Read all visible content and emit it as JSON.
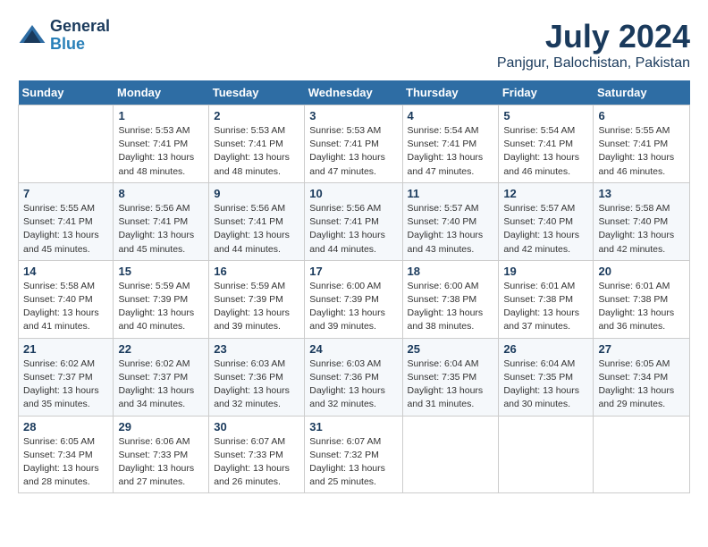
{
  "header": {
    "logo_general": "General",
    "logo_blue": "Blue",
    "title": "July 2024",
    "subtitle": "Panjgur, Balochistan, Pakistan"
  },
  "calendar": {
    "columns": [
      "Sunday",
      "Monday",
      "Tuesday",
      "Wednesday",
      "Thursday",
      "Friday",
      "Saturday"
    ],
    "weeks": [
      [
        {
          "day": "",
          "info": ""
        },
        {
          "day": "1",
          "info": "Sunrise: 5:53 AM\nSunset: 7:41 PM\nDaylight: 13 hours\nand 48 minutes."
        },
        {
          "day": "2",
          "info": "Sunrise: 5:53 AM\nSunset: 7:41 PM\nDaylight: 13 hours\nand 48 minutes."
        },
        {
          "day": "3",
          "info": "Sunrise: 5:53 AM\nSunset: 7:41 PM\nDaylight: 13 hours\nand 47 minutes."
        },
        {
          "day": "4",
          "info": "Sunrise: 5:54 AM\nSunset: 7:41 PM\nDaylight: 13 hours\nand 47 minutes."
        },
        {
          "day": "5",
          "info": "Sunrise: 5:54 AM\nSunset: 7:41 PM\nDaylight: 13 hours\nand 46 minutes."
        },
        {
          "day": "6",
          "info": "Sunrise: 5:55 AM\nSunset: 7:41 PM\nDaylight: 13 hours\nand 46 minutes."
        }
      ],
      [
        {
          "day": "7",
          "info": "Sunrise: 5:55 AM\nSunset: 7:41 PM\nDaylight: 13 hours\nand 45 minutes."
        },
        {
          "day": "8",
          "info": "Sunrise: 5:56 AM\nSunset: 7:41 PM\nDaylight: 13 hours\nand 45 minutes."
        },
        {
          "day": "9",
          "info": "Sunrise: 5:56 AM\nSunset: 7:41 PM\nDaylight: 13 hours\nand 44 minutes."
        },
        {
          "day": "10",
          "info": "Sunrise: 5:56 AM\nSunset: 7:41 PM\nDaylight: 13 hours\nand 44 minutes."
        },
        {
          "day": "11",
          "info": "Sunrise: 5:57 AM\nSunset: 7:40 PM\nDaylight: 13 hours\nand 43 minutes."
        },
        {
          "day": "12",
          "info": "Sunrise: 5:57 AM\nSunset: 7:40 PM\nDaylight: 13 hours\nand 42 minutes."
        },
        {
          "day": "13",
          "info": "Sunrise: 5:58 AM\nSunset: 7:40 PM\nDaylight: 13 hours\nand 42 minutes."
        }
      ],
      [
        {
          "day": "14",
          "info": "Sunrise: 5:58 AM\nSunset: 7:40 PM\nDaylight: 13 hours\nand 41 minutes."
        },
        {
          "day": "15",
          "info": "Sunrise: 5:59 AM\nSunset: 7:39 PM\nDaylight: 13 hours\nand 40 minutes."
        },
        {
          "day": "16",
          "info": "Sunrise: 5:59 AM\nSunset: 7:39 PM\nDaylight: 13 hours\nand 39 minutes."
        },
        {
          "day": "17",
          "info": "Sunrise: 6:00 AM\nSunset: 7:39 PM\nDaylight: 13 hours\nand 39 minutes."
        },
        {
          "day": "18",
          "info": "Sunrise: 6:00 AM\nSunset: 7:38 PM\nDaylight: 13 hours\nand 38 minutes."
        },
        {
          "day": "19",
          "info": "Sunrise: 6:01 AM\nSunset: 7:38 PM\nDaylight: 13 hours\nand 37 minutes."
        },
        {
          "day": "20",
          "info": "Sunrise: 6:01 AM\nSunset: 7:38 PM\nDaylight: 13 hours\nand 36 minutes."
        }
      ],
      [
        {
          "day": "21",
          "info": "Sunrise: 6:02 AM\nSunset: 7:37 PM\nDaylight: 13 hours\nand 35 minutes."
        },
        {
          "day": "22",
          "info": "Sunrise: 6:02 AM\nSunset: 7:37 PM\nDaylight: 13 hours\nand 34 minutes."
        },
        {
          "day": "23",
          "info": "Sunrise: 6:03 AM\nSunset: 7:36 PM\nDaylight: 13 hours\nand 32 minutes."
        },
        {
          "day": "24",
          "info": "Sunrise: 6:03 AM\nSunset: 7:36 PM\nDaylight: 13 hours\nand 32 minutes."
        },
        {
          "day": "25",
          "info": "Sunrise: 6:04 AM\nSunset: 7:35 PM\nDaylight: 13 hours\nand 31 minutes."
        },
        {
          "day": "26",
          "info": "Sunrise: 6:04 AM\nSunset: 7:35 PM\nDaylight: 13 hours\nand 30 minutes."
        },
        {
          "day": "27",
          "info": "Sunrise: 6:05 AM\nSunset: 7:34 PM\nDaylight: 13 hours\nand 29 minutes."
        }
      ],
      [
        {
          "day": "28",
          "info": "Sunrise: 6:05 AM\nSunset: 7:34 PM\nDaylight: 13 hours\nand 28 minutes."
        },
        {
          "day": "29",
          "info": "Sunrise: 6:06 AM\nSunset: 7:33 PM\nDaylight: 13 hours\nand 27 minutes."
        },
        {
          "day": "30",
          "info": "Sunrise: 6:07 AM\nSunset: 7:33 PM\nDaylight: 13 hours\nand 26 minutes."
        },
        {
          "day": "31",
          "info": "Sunrise: 6:07 AM\nSunset: 7:32 PM\nDaylight: 13 hours\nand 25 minutes."
        },
        {
          "day": "",
          "info": ""
        },
        {
          "day": "",
          "info": ""
        },
        {
          "day": "",
          "info": ""
        }
      ]
    ]
  }
}
